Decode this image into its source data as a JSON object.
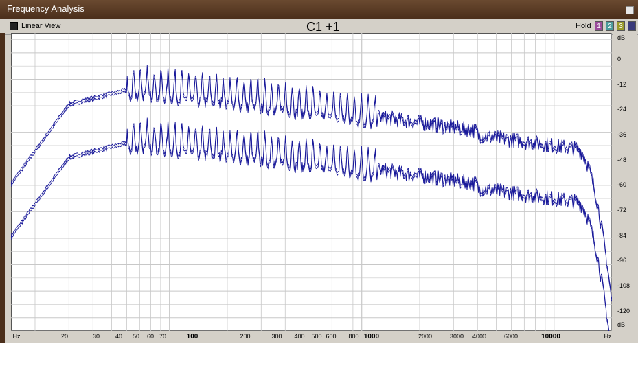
{
  "window": {
    "title": "Frequency Analysis"
  },
  "toolbar": {
    "view_label": "Linear View",
    "channel_label": "C1 +1",
    "hold_label": "Hold",
    "hold_buttons": [
      "1",
      "2",
      "3",
      ""
    ]
  },
  "y_axis": {
    "unit_top": "dB",
    "unit_bottom": "dB",
    "ticks": [
      "0",
      "-12",
      "-24",
      "-36",
      "-48",
      "-60",
      "-72",
      "-84",
      "-96",
      "-108",
      "-120"
    ]
  },
  "x_axis": {
    "unit_left": "Hz",
    "unit_right": "Hz",
    "ticks": [
      "20",
      "30",
      "40",
      "50",
      "60",
      "70",
      "100",
      "200",
      "300",
      "400",
      "500",
      "600",
      "800",
      "1000",
      "2000",
      "3000",
      "4000",
      "6000",
      "10000"
    ]
  },
  "colors": {
    "trace": "#1a1a9a",
    "grid": "#c8c8c8",
    "hold_1": "#9a4a9a",
    "hold_2": "#4a9a9a",
    "hold_3": "#9a9a2a",
    "hold_4": "#3a3a7a"
  }
}
